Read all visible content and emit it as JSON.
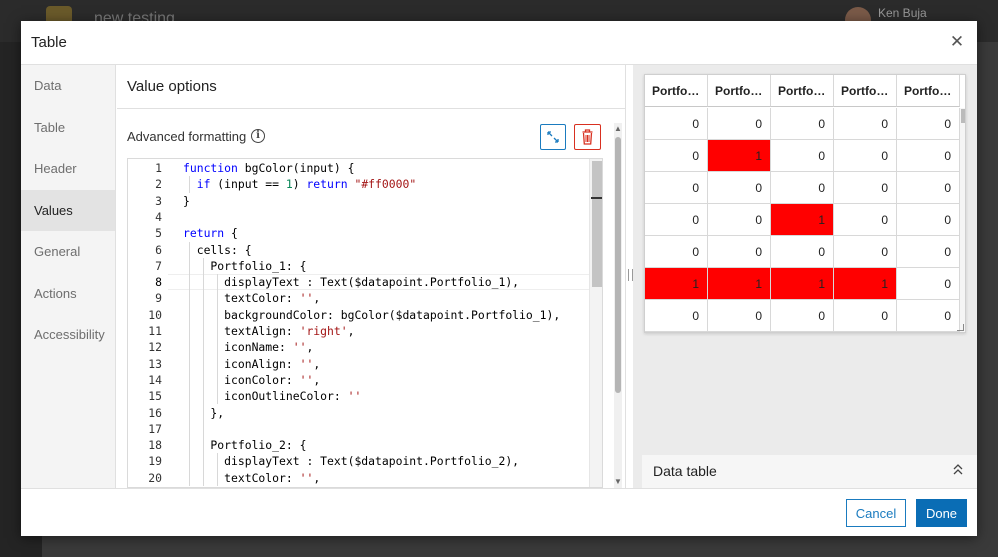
{
  "background": {
    "app_title": "new testing",
    "user_name": "Ken Buja"
  },
  "modal": {
    "title": "Table",
    "close_icon": "close-icon"
  },
  "nav": {
    "items": [
      {
        "label": "Data",
        "active": false
      },
      {
        "label": "Table",
        "active": false
      },
      {
        "label": "Header",
        "active": false
      },
      {
        "label": "Values",
        "active": true
      },
      {
        "label": "General",
        "active": false
      },
      {
        "label": "Actions",
        "active": false
      },
      {
        "label": "Accessibility",
        "active": false
      }
    ]
  },
  "value_options": {
    "title": "Value options",
    "advanced_formatting_label": "Advanced formatting",
    "icons": [
      "info-icon",
      "expand-icon",
      "trash-icon"
    ]
  },
  "code": {
    "current_line": 8,
    "lines": [
      {
        "n": "1",
        "text": "function bgColor(input) {"
      },
      {
        "n": "2",
        "text": "  if (input == 1) return \"#ff0000\""
      },
      {
        "n": "3",
        "text": "}"
      },
      {
        "n": "4",
        "text": ""
      },
      {
        "n": "5",
        "text": "return {"
      },
      {
        "n": "6",
        "text": "  cells: {"
      },
      {
        "n": "7",
        "text": "    Portfolio_1: {"
      },
      {
        "n": "8",
        "text": "      displayText : Text($datapoint.Portfolio_1),"
      },
      {
        "n": "9",
        "text": "      textColor: '',"
      },
      {
        "n": "10",
        "text": "      backgroundColor: bgColor($datapoint.Portfolio_1),"
      },
      {
        "n": "11",
        "text": "      textAlign: 'right',"
      },
      {
        "n": "12",
        "text": "      iconName: '',"
      },
      {
        "n": "13",
        "text": "      iconAlign: '',"
      },
      {
        "n": "14",
        "text": "      iconColor: '',"
      },
      {
        "n": "15",
        "text": "      iconOutlineColor: ''"
      },
      {
        "n": "16",
        "text": "    },"
      },
      {
        "n": "17",
        "text": ""
      },
      {
        "n": "18",
        "text": "    Portfolio_2: {"
      },
      {
        "n": "19",
        "text": "      displayText : Text($datapoint.Portfolio_2),"
      },
      {
        "n": "20",
        "text": "      textColor: '',"
      }
    ]
  },
  "preview_table": {
    "headers": [
      "Portfo…",
      "Portfo…",
      "Portfo…",
      "Portfo…",
      "Portfo…"
    ],
    "rows": [
      [
        "0",
        "0",
        "0",
        "0",
        "0"
      ],
      [
        "0",
        "1",
        "0",
        "0",
        "0"
      ],
      [
        "0",
        "0",
        "0",
        "0",
        "0"
      ],
      [
        "0",
        "0",
        "1",
        "0",
        "0"
      ],
      [
        "0",
        "0",
        "0",
        "0",
        "0"
      ],
      [
        "1",
        "1",
        "1",
        "1",
        "0"
      ],
      [
        "0",
        "0",
        "0",
        "0",
        "0"
      ]
    ],
    "highlight_color": "#ff0000"
  },
  "data_table_section": {
    "label": "Data table",
    "icon": "chevrons-up-icon"
  },
  "footer": {
    "cancel_label": "Cancel",
    "done_label": "Done"
  },
  "colors": {
    "accent": "#0a6db5",
    "danger": "#d83020"
  }
}
